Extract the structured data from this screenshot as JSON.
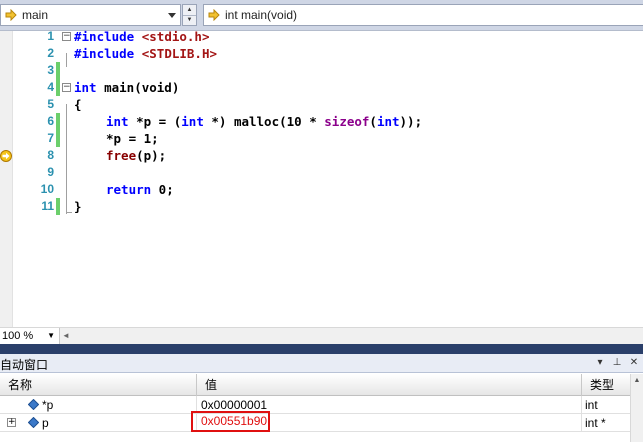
{
  "navbar": {
    "scope_combo": "main",
    "function_combo": "int main(void)"
  },
  "code_lines": [
    {
      "num": "1"
    },
    {
      "num": "2"
    },
    {
      "num": "3"
    },
    {
      "num": "4"
    },
    {
      "num": "5"
    },
    {
      "num": "6"
    },
    {
      "num": "7"
    },
    {
      "num": "8"
    },
    {
      "num": "9"
    },
    {
      "num": "10"
    },
    {
      "num": "11"
    }
  ],
  "code": {
    "l1_dir": "#include",
    "l1_hdr": "<stdio.h>",
    "l2_dir": "#include",
    "l2_hdr": "<STDLIB.H>",
    "l4_kw": "int",
    "l4_rest": " main(void)",
    "l5": "{",
    "l6_kw1": "int",
    "l6_a": " *p = (",
    "l6_kw2": "int",
    "l6_b": " *) malloc(10 * ",
    "l6_sz": "sizeof",
    "l6_c": "(",
    "l6_kw3": "int",
    "l6_d": "));",
    "l7": "*p = 1;",
    "l8_fn": "free",
    "l8_rest": "(p);",
    "l10_kw": "return",
    "l10_rest": " 0;",
    "l11": "}"
  },
  "statusbar": {
    "zoom": "100 %"
  },
  "autos": {
    "title": "自动窗口",
    "columns": {
      "name": "名称",
      "value": "值",
      "type": "类型"
    },
    "rows": [
      {
        "name": "*p",
        "value": "0x00000001",
        "type": "int",
        "expandable": false
      },
      {
        "name": "p",
        "value": "0x00551b90",
        "type": "int *",
        "expandable": true,
        "changed": true
      }
    ]
  },
  "colors": {
    "keyword": "#0000ff",
    "string": "#a31515",
    "line_number": "#2b91af",
    "changed_value": "#e01010",
    "change_bar": "#6ccf6c",
    "splitter": "#2a3f6a"
  },
  "icons": {
    "navbar": "yellow-arrow-icon",
    "breakpoint": "current-statement-arrow-icon",
    "variable": "blue-diamond-icon"
  }
}
